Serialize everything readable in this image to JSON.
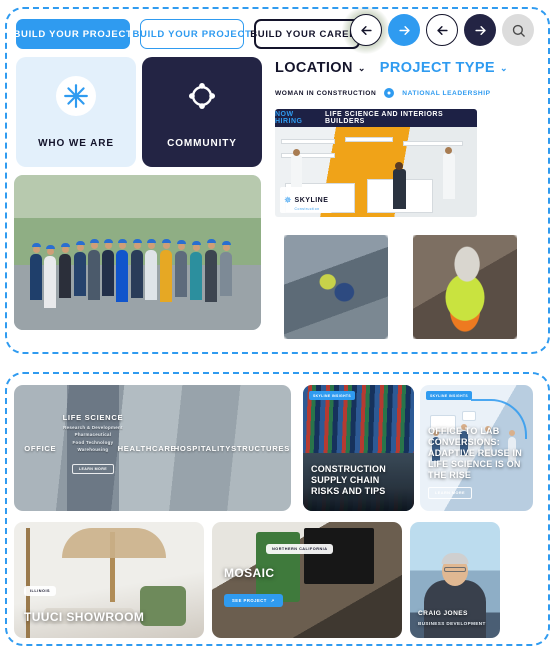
{
  "top": {
    "buttons": [
      {
        "label": "BUILD YOUR PROJECT",
        "style": "filled"
      },
      {
        "label": "BUILD YOUR PROJECT",
        "style": "outline-blue"
      },
      {
        "label": "BUILD YOUR CAREER",
        "style": "outline-dark"
      }
    ],
    "nav_circles": [
      {
        "icon": "arrow-left-icon",
        "style": "white-glow"
      },
      {
        "icon": "arrow-right-icon",
        "style": "blue"
      },
      {
        "icon": "arrow-left-icon",
        "style": "white"
      },
      {
        "icon": "arrow-right-icon",
        "style": "navy"
      },
      {
        "icon": "search-icon",
        "style": "grey"
      }
    ]
  },
  "tiles": [
    {
      "label": "WHO WE ARE",
      "icon": "asterisk-icon",
      "theme": "light"
    },
    {
      "label": "COMMUNITY",
      "icon": "community-ring-icon",
      "theme": "dark"
    }
  ],
  "filters": {
    "location": {
      "label": "LOCATION",
      "chevron": "⌄"
    },
    "project_type": {
      "label": "PROJECT TYPE",
      "chevron": "⌄"
    }
  },
  "tags": {
    "left": "WOMAN IN CONSTRUCTION",
    "right": "NATIONAL LEADERSHIP",
    "pin_icon": "location-pin-icon"
  },
  "banner": {
    "headline_highlight": "NOW HIRING",
    "headline_rest": "LIFE SCIENCE AND INTERIORS BUILDERS",
    "logo_name": "SKYLINE",
    "logo_sub": "Construction",
    "logo_mark": "✵"
  },
  "worker_photos": [
    {
      "alt_name": "rebar-crew-photo"
    },
    {
      "alt_name": "worker-portrait-photo"
    }
  ],
  "group_photo": {
    "alt_name": "company-team-group-photo"
  },
  "sectors": {
    "items": [
      {
        "label": "OFFICE"
      },
      {
        "label": "LIFE SCIENCE",
        "sublabels": [
          "Research & Development",
          "Pharmaceutical",
          "Food Technology",
          "Warehousing"
        ],
        "button": "LEARN MORE"
      },
      {
        "label": "HEALTHCARE"
      },
      {
        "label": "HOSPITALITY"
      },
      {
        "label": "STRUCTURES"
      }
    ]
  },
  "blogs": [
    {
      "badge": "SKYLINE INSIGHTS",
      "title": "CONSTRUCTION SUPPLY CHAIN RISKS AND TIPS",
      "button": null
    },
    {
      "badge": "SKYLINE INSIGHTS",
      "title": "OFFICE TO LAB CONVERSIONS: ADAPTIVE REUSE IN LIFE SCIENCE IS ON THE RISE",
      "button": "LEARN MORE"
    }
  ],
  "projects": [
    {
      "location": "ILLINOIS",
      "title": "TUUCI SHOWROOM",
      "button": null
    },
    {
      "location": "NORTHERN CALIFORNIA",
      "title": "MOSAIC",
      "button": "SEE PROJECT",
      "button_arrow": "↗"
    }
  ],
  "person": {
    "name": "CRAIG JONES",
    "role": "BUSINESS DEVELOPMENT"
  },
  "colors": {
    "accent_blue": "#2f9bf0",
    "navy": "#232444",
    "ink": "#14142b",
    "light_blue_bg": "#e3f0fb",
    "dashed_border": "#2f9bf0"
  }
}
